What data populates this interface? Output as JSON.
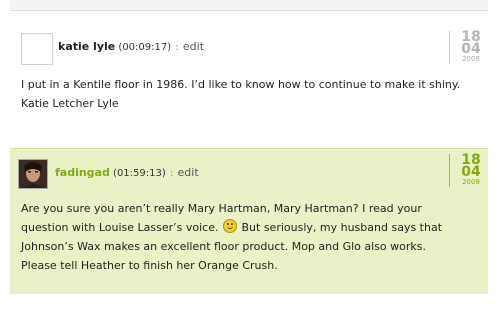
{
  "comments": [
    {
      "author": "katie lyle",
      "time": "(00:09:17)",
      "separator": ":",
      "edit_label": "edit",
      "date": {
        "day": "18",
        "month": "04",
        "year": "2008"
      },
      "body": "I put in a Kentile floor in 1986. I’d like to know how to continue to make it shiny. Katie Letcher Lyle"
    },
    {
      "author": "fadingad",
      "time": "(01:59:13)",
      "separator": ":",
      "edit_label": "edit",
      "date": {
        "day": "18",
        "month": "04",
        "year": "2008"
      },
      "body_part1": "Are you sure you aren’t really Mary Hartman, Mary Hartman? I read your question with Louise Lasser’s voice.",
      "body_part2": "But seriously, my husband says that Johnson’s Wax makes an excellent floor product. Mop and Glo also works. Please tell Heather to finish her Orange Crush.",
      "emoticon": "smiley-icon"
    }
  ],
  "colors": {
    "highlight_bg": "#e8f2c6",
    "accent": "#84a90e"
  }
}
